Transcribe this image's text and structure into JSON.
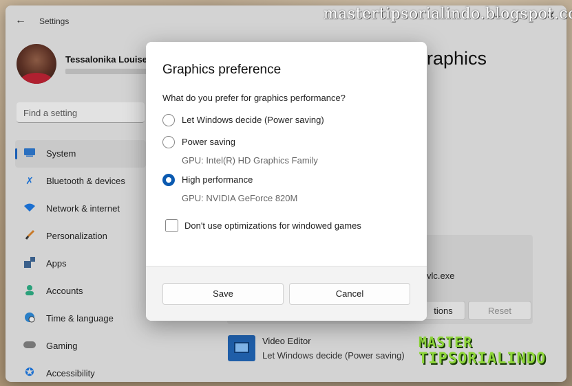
{
  "window": {
    "title": "Settings"
  },
  "watermark": "mastertipsorialindo.blogspot.com",
  "user": {
    "name": "Tessalonika Louise"
  },
  "search": {
    "placeholder": "Find a setting"
  },
  "sidebar": {
    "items": [
      {
        "label": "System",
        "icon": "monitor-icon",
        "active": true
      },
      {
        "label": "Bluetooth & devices",
        "icon": "bluetooth-icon"
      },
      {
        "label": "Network & internet",
        "icon": "wifi-icon"
      },
      {
        "label": "Personalization",
        "icon": "brush-icon"
      },
      {
        "label": "Apps",
        "icon": "apps-icon"
      },
      {
        "label": "Accounts",
        "icon": "person-icon"
      },
      {
        "label": "Time & language",
        "icon": "globe-clock-icon"
      },
      {
        "label": "Gaming",
        "icon": "gamepad-icon"
      },
      {
        "label": "Accessibility",
        "icon": "accessibility-icon"
      }
    ]
  },
  "main": {
    "heading_fragment": "raphics",
    "card": {
      "exe": "vlc.exe",
      "options_label": "tions",
      "reset_label": "Reset"
    },
    "app": {
      "name": "Video Editor",
      "setting": "Let Windows decide (Power saving)"
    }
  },
  "logo": {
    "line1": "MASTER",
    "line2": "TIPSORIALINDO"
  },
  "dialog": {
    "title": "Graphics preference",
    "question": "What do you prefer for graphics performance?",
    "options": [
      {
        "label": "Let Windows decide (Power saving)",
        "checked": false,
        "gpu": ""
      },
      {
        "label": "Power saving",
        "checked": false,
        "gpu": "GPU: Intel(R) HD Graphics Family"
      },
      {
        "label": "High performance",
        "checked": true,
        "gpu": "GPU: NVIDIA GeForce 820M"
      }
    ],
    "checkbox": {
      "label": "Don't use optimizations for windowed games",
      "checked": false
    },
    "save_label": "Save",
    "cancel_label": "Cancel"
  },
  "colors": {
    "accent": "#0b5ab0",
    "logo_green": "#8ed63a"
  }
}
